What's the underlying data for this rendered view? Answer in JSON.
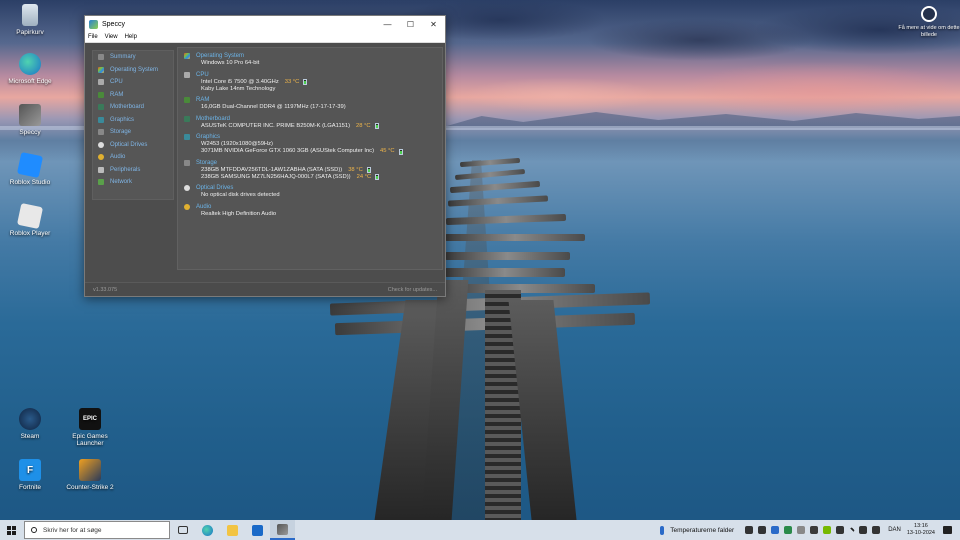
{
  "desktop": {
    "icons_left": [
      {
        "label": "Papirkurv"
      },
      {
        "label": "Microsoft Edge"
      },
      {
        "label": "Speccy"
      },
      {
        "label": "Roblox Studio"
      },
      {
        "label": "Roblox Player"
      },
      {
        "label": "Steam"
      },
      {
        "label": "Fortnite"
      }
    ],
    "icons_col2": [
      {
        "label": "Epic Games Launcher"
      },
      {
        "label": "Counter-Strike 2"
      }
    ],
    "spotlight_label": "Få mere at vide om dette billede"
  },
  "window": {
    "title": "Speccy",
    "menu": [
      "File",
      "View",
      "Help"
    ],
    "nav": [
      "Summary",
      "Operating System",
      "CPU",
      "RAM",
      "Motherboard",
      "Graphics",
      "Storage",
      "Optical Drives",
      "Audio",
      "Peripherals",
      "Network"
    ],
    "sections": {
      "os": {
        "title": "Operating System",
        "line1": "Windows 10 Pro 64-bit"
      },
      "cpu": {
        "title": "CPU",
        "line1": "Intel Core i5 7500 @ 3.40GHz",
        "temp1": "33 °C",
        "line2": "Kaby Lake 14nm Technology"
      },
      "ram": {
        "title": "RAM",
        "line1": "16,0GB Dual-Channel DDR4 @ 1197MHz (17-17-17-39)"
      },
      "mb": {
        "title": "Motherboard",
        "line1": "ASUSTeK COMPUTER INC. PRIME B250M-K (LGA1151)",
        "temp1": "28 °C"
      },
      "gfx": {
        "title": "Graphics",
        "line1": "W2453 (1920x1080@59Hz)",
        "line2": "3071MB NVIDIA GeForce GTX 1060 3GB (ASUStek Computer Inc)",
        "temp2": "45 °C"
      },
      "storage": {
        "title": "Storage",
        "line1": "238GB MTFDDAV256TDL-1AW1ZABHA (SATA (SSD))",
        "temp1": "38 °C",
        "line2": "238GB SAMSUNG MZ7LN256HAJQ-000L7 (SATA (SSD))",
        "temp2": "24 °C"
      },
      "optical": {
        "title": "Optical Drives",
        "line1": "No optical disk drives detected"
      },
      "audio": {
        "title": "Audio",
        "line1": "Realtek High Definition Audio"
      }
    },
    "version": "v1.33.075",
    "check_updates": "Check for updates..."
  },
  "taskbar": {
    "search_placeholder": "Skriv her for at søge",
    "weather": "Temperaturerne falder",
    "language": "DAN",
    "time": "13:16",
    "date": "13-10-2024"
  },
  "colors": {
    "accent_link": "#6cb4e8",
    "temp": "#f0b64a",
    "taskbar_bg": "#d7e0ea"
  }
}
